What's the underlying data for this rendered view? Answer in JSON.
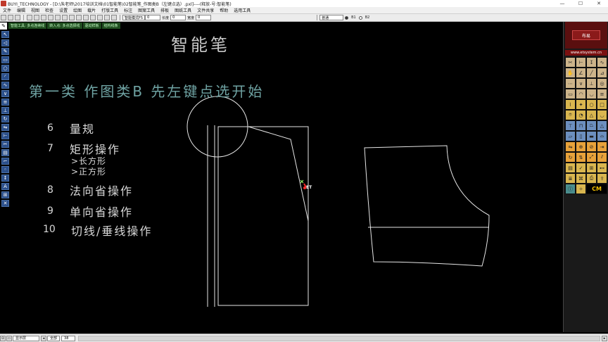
{
  "window": {
    "title": "BUYI_TECHNOLOGY - [D:\\朱老师\\2017培训文档\\01智能笔\\02智能笔_作图类B（左键点选）.pxl]----(释放-号:智能笔)",
    "minimize": "—",
    "maximize": "☐",
    "close": "✕"
  },
  "menu": {
    "items": [
      "文件",
      "编辑",
      "视图",
      "检查",
      "设置",
      "绘图",
      "载片",
      "打版工具",
      "标注",
      "图案工具",
      "排板",
      "图纸工具",
      "文件共享",
      "帮助",
      "选用工具"
    ]
  },
  "toolbar": {
    "mode_select": "智能模式F5",
    "field1_label": "长度",
    "field1_value": "0",
    "field2_label": "宽度",
    "field2_value": "0",
    "layer_select": "普通",
    "radio1_label": "B1",
    "radio2_label": "B2"
  },
  "promptbar": {
    "segments": [
      "智能工具: 多点连续线",
      "转入点: 多点选择线",
      "驱动样板",
      "结构线条"
    ]
  },
  "canvas": {
    "heading": "智能笔",
    "subheading": "第一类  作图类B  先左键点选开始",
    "list": [
      {
        "num": "6",
        "label": "量规"
      },
      {
        "num": "7",
        "label": "矩形操作",
        "subs": [
          ">长方形",
          ">正方形"
        ]
      },
      {
        "num": "8",
        "label": "法向省操作"
      },
      {
        "num": "9",
        "label": "单向省操作"
      },
      {
        "num": "10",
        "label": "切线/垂线操作"
      }
    ],
    "cursor_label": "ET"
  },
  "rightpanel": {
    "logo_text": "布易",
    "url": "www.etsystem.cn",
    "cm_label": "CM"
  },
  "statusbar": {
    "layer": "显示层",
    "zoom_label": "全部",
    "zoom_value": "38"
  },
  "colors": {
    "background": "#000000",
    "drawing_lines": "#e6e6e6",
    "heading_text": "#c8c8c8",
    "subheading_text": "#6fa3a3",
    "cursor_red": "#ff2a2a"
  }
}
